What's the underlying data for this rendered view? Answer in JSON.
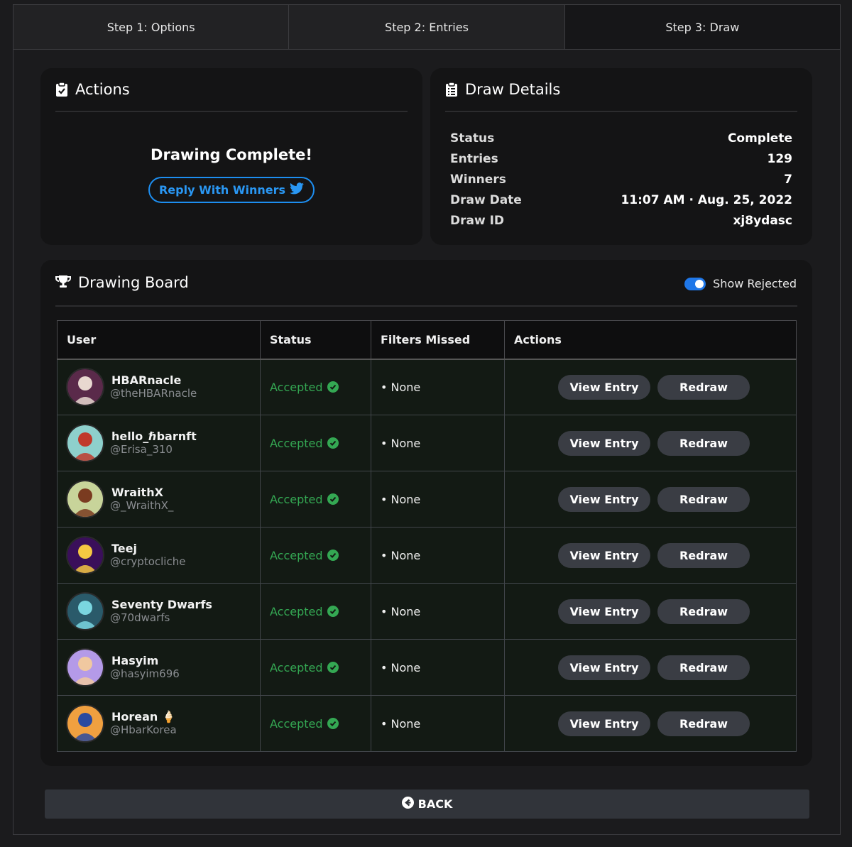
{
  "steps": [
    {
      "label": "Step 1: Options"
    },
    {
      "label": "Step 2: Entries"
    },
    {
      "label": "Step 3: Draw",
      "active": true
    }
  ],
  "actions": {
    "title": "Actions",
    "icon": "clipboard-check-icon",
    "complete_text": "Drawing Complete!",
    "reply_label": "Reply With Winners",
    "reply_icon": "twitter-bird-icon",
    "accent": "#1d8ef0"
  },
  "details": {
    "title": "Draw Details",
    "icon": "clipboard-list-icon",
    "rows": [
      {
        "label": "Status",
        "value": "Complete"
      },
      {
        "label": "Entries",
        "value": "129"
      },
      {
        "label": "Winners",
        "value": "7"
      },
      {
        "label": "Draw Date",
        "value": "11:07 AM · Aug. 25, 2022"
      },
      {
        "label": "Draw ID",
        "value": "xj8ydasc"
      }
    ]
  },
  "board": {
    "title": "Drawing Board",
    "icon": "trophy-icon",
    "toggle_label": "Show Rejected",
    "toggle_on": true,
    "columns": [
      "User",
      "Status",
      "Filters Missed",
      "Actions"
    ],
    "view_label": "View Entry",
    "redraw_label": "Redraw",
    "status_color": "#34a853",
    "rows": [
      {
        "name": "HBARnacle",
        "handle": "@theHBARnacle",
        "status": "Accepted",
        "filters": "• None",
        "avatar_bg": "#5a2a4a",
        "avatar_fg": "#e8d8d0"
      },
      {
        "name": "hello_ℏbarnft",
        "handle": "@Erisa_310",
        "status": "Accepted",
        "filters": "• None",
        "avatar_bg": "#8ed0cc",
        "avatar_fg": "#c0392b"
      },
      {
        "name": "WraithX",
        "handle": "@_WraithX_",
        "status": "Accepted",
        "filters": "• None",
        "avatar_bg": "#c8d49a",
        "avatar_fg": "#7a3b20"
      },
      {
        "name": "Teej",
        "handle": "@cryptocliche",
        "status": "Accepted",
        "filters": "• None",
        "avatar_bg": "#3a0f5a",
        "avatar_fg": "#f5c842"
      },
      {
        "name": "Seventy Dwarfs",
        "handle": "@70dwarfs",
        "status": "Accepted",
        "filters": "• None",
        "avatar_bg": "#2a5a6a",
        "avatar_fg": "#7ad6e0"
      },
      {
        "name": "Hasyim",
        "handle": "@hasyim696",
        "status": "Accepted",
        "filters": "• None",
        "avatar_bg": "#b49ae8",
        "avatar_fg": "#f0c8a0"
      },
      {
        "name": "Horean 🍦",
        "handle": "@HbarKorea",
        "status": "Accepted",
        "filters": "• None",
        "avatar_bg": "#f0a040",
        "avatar_fg": "#2a4aa0"
      }
    ]
  },
  "back_label": "BACK",
  "back_icon": "arrow-left-circle-icon"
}
